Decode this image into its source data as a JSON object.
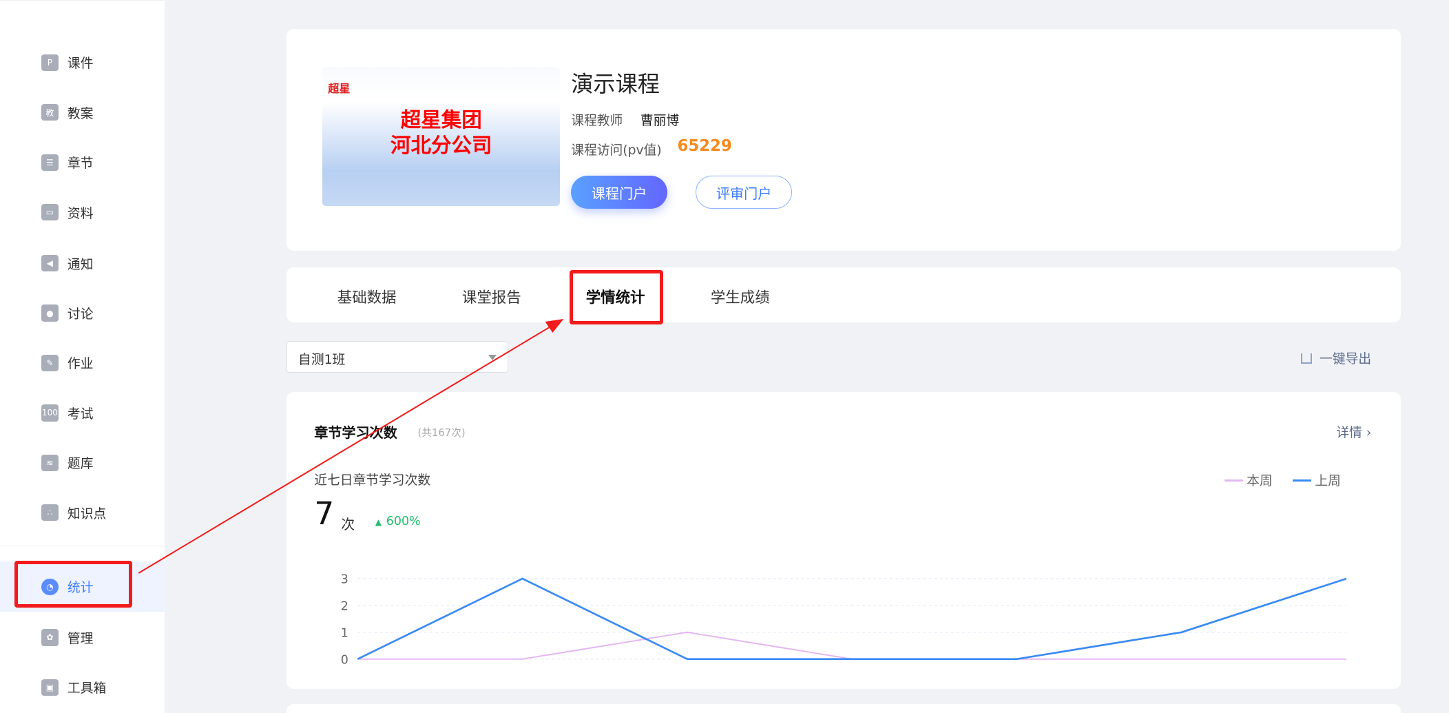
{
  "sidebar": {
    "items": [
      {
        "label": "课件",
        "icon": "P"
      },
      {
        "label": "教案",
        "icon": "教"
      },
      {
        "label": "章节",
        "icon": "☰"
      },
      {
        "label": "资料",
        "icon": "▭"
      },
      {
        "label": "通知",
        "icon": "◀"
      },
      {
        "label": "讨论",
        "icon": "●"
      },
      {
        "label": "作业",
        "icon": "✎"
      },
      {
        "label": "考试",
        "icon": "100"
      },
      {
        "label": "题库",
        "icon": "≋"
      },
      {
        "label": "知识点",
        "icon": "∴"
      },
      {
        "label": "统计",
        "icon": "◔"
      },
      {
        "label": "管理",
        "icon": "✿"
      },
      {
        "label": "工具箱",
        "icon": "▣"
      }
    ]
  },
  "course": {
    "cover_logo": "超星",
    "cover_line1": "超星集团",
    "cover_line2": "河北分公司",
    "title": "演示课程",
    "teacher_label": "课程教师",
    "teacher": "曹丽博",
    "pv_label": "课程访问(pv值)",
    "pv": "65229",
    "portal_btn": "课程门户",
    "review_btn": "评审门户"
  },
  "tabs": [
    "基础数据",
    "课堂报告",
    "学情统计",
    "学生成绩"
  ],
  "class_select": "自测1班",
  "export_label": "一键导出",
  "stats": {
    "title": "章节学习次数",
    "total": "(共167次)",
    "detail": "详情 ›",
    "subtitle": "近七日章节学习次数",
    "count": "7",
    "unit": "次",
    "change": "600%"
  },
  "colors": {
    "this_week": "#e3b8f0",
    "last_week": "#3a8af5",
    "up": "#1fbf6a",
    "pv": "#f58a1f"
  },
  "chart_data": {
    "type": "line",
    "ylim": [
      0,
      3
    ],
    "yticks": [
      "0",
      "1",
      "2",
      "3"
    ],
    "legend": [
      "本周",
      "上周"
    ],
    "series": [
      {
        "name": "本周",
        "values": [
          0,
          0,
          1,
          0,
          0,
          0,
          0
        ]
      },
      {
        "name": "上周",
        "values": [
          0,
          3,
          0,
          0,
          0,
          1,
          3
        ]
      }
    ]
  }
}
